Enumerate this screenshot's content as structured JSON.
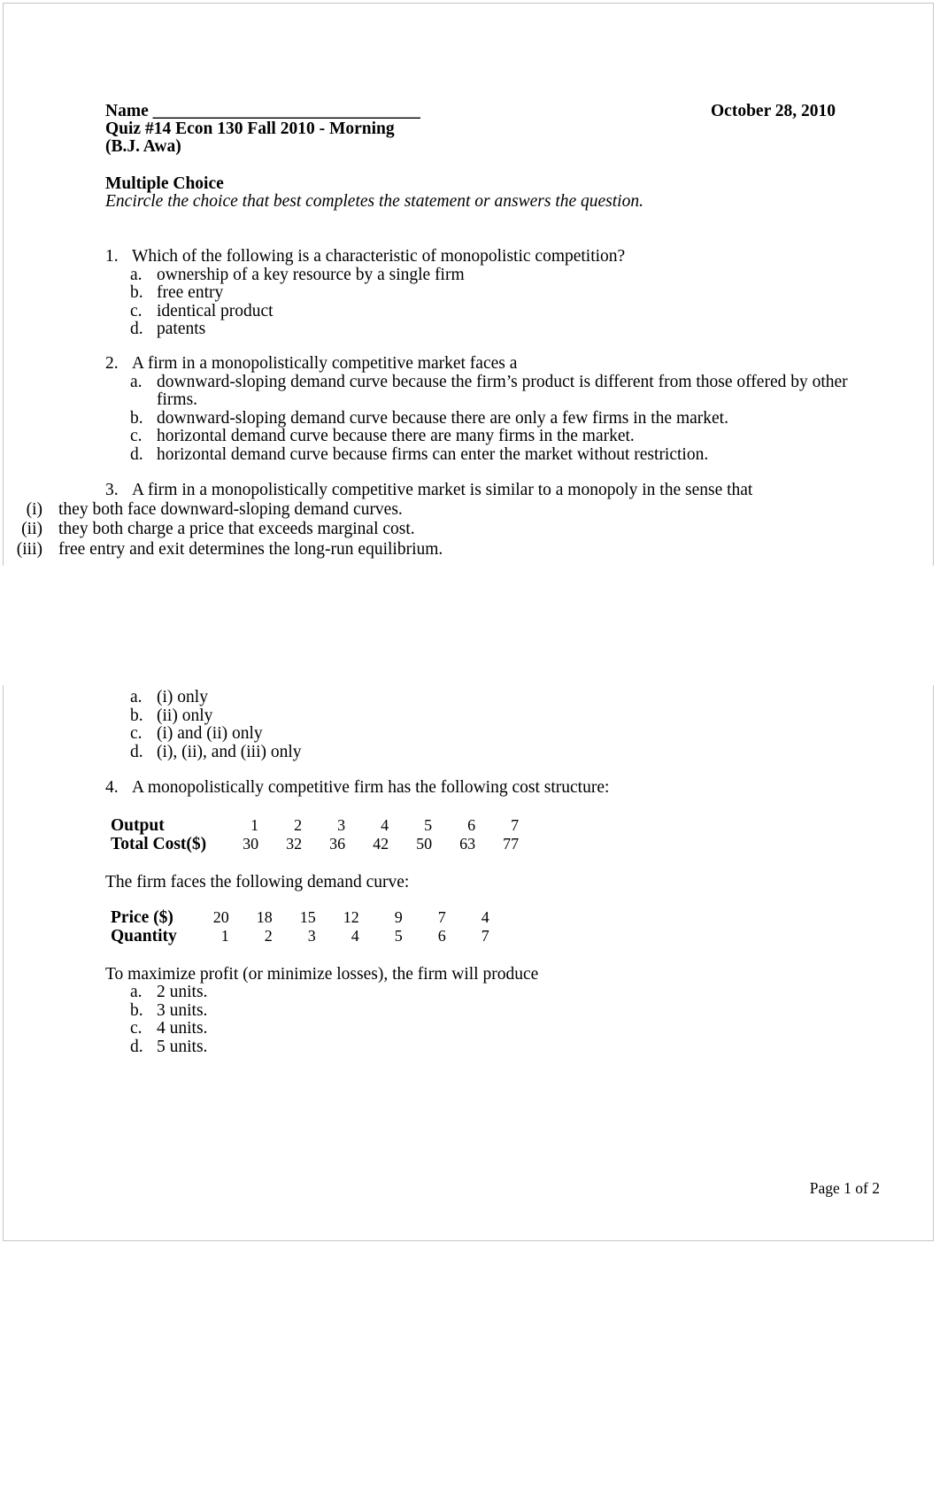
{
  "document": {
    "icon": "broken-image-icon",
    "header": {
      "name_line": "Name  _______________________________",
      "quiz_line": "Quiz #14 Econ 130 Fall 2010 - Morning",
      "instructor": "(B.J. Awa)",
      "date": "October 28, 2010"
    },
    "instructions": {
      "title": "Multiple Choice",
      "subtitle": "Encircle the choice that best completes the statement or answers the question."
    },
    "questions": [
      {
        "number": "1.",
        "text": "Which of the following is a characteristic of monopolistic competition?",
        "options": [
          {
            "letter": "a.",
            "text": "ownership of a key resource by a single firm"
          },
          {
            "letter": "b.",
            "text": "free entry"
          },
          {
            "letter": "c.",
            "text": "identical product"
          },
          {
            "letter": "d.",
            "text": "patents"
          }
        ]
      },
      {
        "number": "2.",
        "text": "A firm in a monopolistically competitive market faces a",
        "options": [
          {
            "letter": "a.",
            "text": "downward-sloping demand curve because the firm’s product is different from those offered by other firms."
          },
          {
            "letter": "b.",
            "text": "downward-sloping demand curve because there are only a few firms in the market."
          },
          {
            "letter": "c.",
            "text": "horizontal demand curve because there are many firms in the market."
          },
          {
            "letter": "d.",
            "text": "horizontal demand curve because firms can enter the market without restriction."
          }
        ]
      },
      {
        "number": "3.",
        "text": "A firm in a monopolistically competitive market is similar to a monopoly in the sense that",
        "romans": [
          {
            "label": "(i)",
            "text": "they both face downward-sloping demand curves."
          },
          {
            "label": "(ii)",
            "text": "they both charge a price that exceeds marginal cost."
          },
          {
            "label": "(iii)",
            "text": "free entry and exit determines the long-run equilibrium."
          }
        ],
        "options": [
          {
            "letter": "a.",
            "text": "(i) only"
          },
          {
            "letter": "b.",
            "text": "(ii) only"
          },
          {
            "letter": "c.",
            "text": "(i) and (ii) only"
          },
          {
            "letter": "d.",
            "text": "(i), (ii), and (iii) only"
          }
        ]
      },
      {
        "number": "4.",
        "text": "A monopolistically competitive firm has the following cost structure:",
        "demand_intro": "The firm faces the following demand curve:",
        "stem": "To maximize profit (or minimize losses), the firm will produce",
        "options": [
          {
            "letter": "a.",
            "text": "2 units."
          },
          {
            "letter": "b.",
            "text": "3 units."
          },
          {
            "letter": "c.",
            "text": "4 units."
          },
          {
            "letter": "d.",
            "text": "5 units."
          }
        ]
      }
    ],
    "cost_table": {
      "rows": [
        {
          "header": "Output",
          "values": [
            "1",
            "2",
            "3",
            "4",
            "5",
            "6",
            "7"
          ]
        },
        {
          "header": "Total Cost($)",
          "values": [
            "30",
            "32",
            "36",
            "42",
            "50",
            "63",
            "77"
          ]
        }
      ]
    },
    "demand_table": {
      "rows": [
        {
          "header": "Price ($)",
          "values": [
            "20",
            "18",
            "15",
            "12",
            "9",
            "7",
            "4"
          ]
        },
        {
          "header": "Quantity",
          "values": [
            "1",
            "2",
            "3",
            "4",
            "5",
            "6",
            "7"
          ]
        }
      ]
    },
    "footer": {
      "page": "Page 1 of 2"
    }
  }
}
